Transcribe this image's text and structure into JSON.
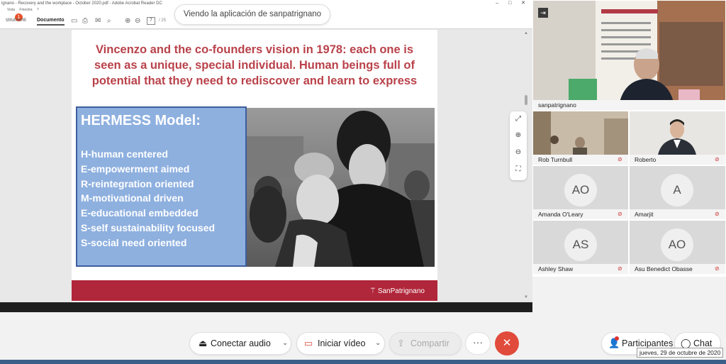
{
  "acrobat": {
    "window_title": "ignano - Recovery and the workplace - October 2020.pdf - Adobe Acrobat Reader DC",
    "window_controls": "–  □  ✕",
    "menu": [
      "Vista",
      "Finestra",
      "?"
    ],
    "tabs": {
      "tools": "strumenti",
      "document": "Documento"
    },
    "notification_count": "1",
    "page_current": "7",
    "page_total": "/ 25"
  },
  "share_banner": "Viendo la aplicación de sanpatrignano",
  "slide": {
    "title": "Vincenzo and the co-founders vision in 1978: each one is seen as a unique, special individual. Human beings full of potential that they need to rediscover and learn to express",
    "model_title": "HERMESS Model:",
    "model_items": [
      "H-human centered",
      "E-empowerment aimed",
      "R-reintegration oriented",
      "M-motivational driven",
      "E-educational embedded",
      "S-self sustainability focused",
      "S-social need oriented"
    ],
    "footer_brand": "SanPatrignano"
  },
  "participants": {
    "main": {
      "name": "sanpatrignano"
    },
    "tiles": [
      {
        "name": "Rob Turnbull",
        "initials": ""
      },
      {
        "name": "Roberto",
        "initials": ""
      },
      {
        "name": "Amanda O'Leary",
        "initials": "AO"
      },
      {
        "name": "Amarjit",
        "initials": "A"
      },
      {
        "name": "Ashley Shaw",
        "initials": "AS"
      },
      {
        "name": "Asu Benedict Obasse",
        "initials": "AO"
      }
    ]
  },
  "controls": {
    "audio": "Conectar audio",
    "video": "Iniciar vídeo",
    "share": "Compartir",
    "more": "···",
    "end": "✕",
    "participants": "Participantes",
    "chat": "Chat"
  },
  "tooltip": "jueves, 29 de octubre de 2020",
  "colors": {
    "slide_title": "#b9424a",
    "model_box": "#8eb0df",
    "footer": "#b0263a",
    "end_button": "#e14b3b"
  }
}
